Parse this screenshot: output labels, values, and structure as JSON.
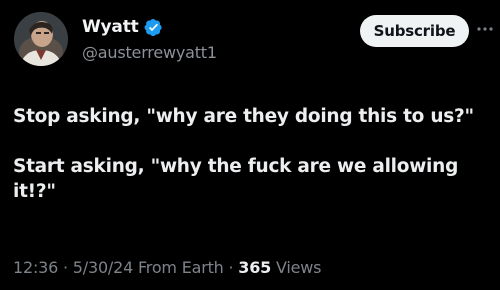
{
  "author": {
    "display_name": "Wyatt",
    "handle": "@austerrewyatt1",
    "verified": true,
    "avatar_icon": "profile-photo",
    "verified_icon": "verified-badge-icon"
  },
  "actions": {
    "subscribe_label": "Subscribe",
    "more_icon": "more-options-icon"
  },
  "tweet": {
    "paragraphs": [
      "Stop asking, \"why are they doing this to us?\"",
      "Start asking, \"why the fuck are we allowing it!?\""
    ]
  },
  "meta": {
    "time": "12:36",
    "separator": "·",
    "date": "5/30/24",
    "source": "From Earth",
    "views_count": "365",
    "views_label": "Views"
  },
  "colors": {
    "background": "#000000",
    "text_primary": "#eceef0",
    "text_secondary": "#7d8389",
    "verified_blue": "#1d9bf0",
    "button_bg": "#eff3f4"
  }
}
